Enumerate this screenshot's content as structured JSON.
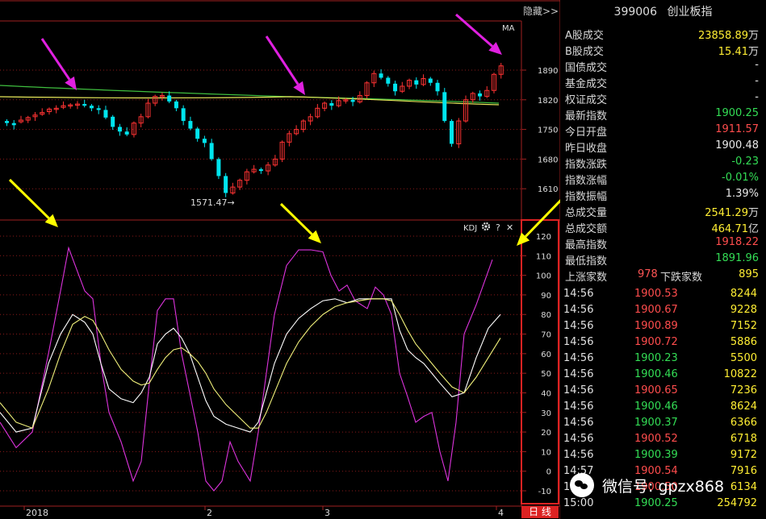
{
  "header": {
    "hide_label": "隐藏>>",
    "ma_label": "MA"
  },
  "sidebar": {
    "code": "399006",
    "name": "创业板指",
    "stats": [
      {
        "label": "A股成交",
        "value": "23858.89",
        "unit": "万",
        "color": "y"
      },
      {
        "label": "B股成交",
        "value": "15.41",
        "unit": "万",
        "color": "y"
      },
      {
        "label": "国债成交",
        "value": "-",
        "unit": "",
        "color": "w"
      },
      {
        "label": "基金成交",
        "value": "-",
        "unit": "",
        "color": "w"
      },
      {
        "label": "权证成交",
        "value": "-",
        "unit": "",
        "color": "w"
      },
      {
        "label": "最新指数",
        "value": "1900.25",
        "unit": "",
        "color": "g"
      },
      {
        "label": "今日开盘",
        "value": "1911.57",
        "unit": "",
        "color": "r"
      },
      {
        "label": "昨日收盘",
        "value": "1900.48",
        "unit": "",
        "color": "w"
      },
      {
        "label": "指数涨跌",
        "value": "-0.23",
        "unit": "",
        "color": "g"
      },
      {
        "label": "指数涨幅",
        "value": "-0.01%",
        "unit": "",
        "color": "g"
      },
      {
        "label": "指数振幅",
        "value": "1.39%",
        "unit": "",
        "color": "w"
      },
      {
        "label": "总成交量",
        "value": "2541.29",
        "unit": "万",
        "color": "y"
      },
      {
        "label": "总成交额",
        "value": "464.71",
        "unit": "亿",
        "color": "y"
      },
      {
        "label": "最高指数",
        "value": "1918.22",
        "unit": "",
        "color": "r"
      },
      {
        "label": "最低指数",
        "value": "1891.96",
        "unit": "",
        "color": "g"
      }
    ],
    "breadth": {
      "up_label": "上涨家数",
      "up_value": "978",
      "down_label": "下跌家数",
      "down_value": "895"
    },
    "ticks": [
      {
        "time": "14:56",
        "price": "1900.53",
        "vol": "8244",
        "color": "r"
      },
      {
        "time": "14:56",
        "price": "1900.67",
        "vol": "9228",
        "color": "r"
      },
      {
        "time": "14:56",
        "price": "1900.89",
        "vol": "7152",
        "color": "r"
      },
      {
        "time": "14:56",
        "price": "1900.72",
        "vol": "5886",
        "color": "r"
      },
      {
        "time": "14:56",
        "price": "1900.23",
        "vol": "5500",
        "color": "g"
      },
      {
        "time": "14:56",
        "price": "1900.46",
        "vol": "10822",
        "color": "g"
      },
      {
        "time": "14:56",
        "price": "1900.65",
        "vol": "7236",
        "color": "r"
      },
      {
        "time": "14:56",
        "price": "1900.46",
        "vol": "8624",
        "color": "g"
      },
      {
        "time": "14:56",
        "price": "1900.37",
        "vol": "6366",
        "color": "g"
      },
      {
        "time": "14:56",
        "price": "1900.52",
        "vol": "6718",
        "color": "r"
      },
      {
        "time": "14:56",
        "price": "1900.39",
        "vol": "9172",
        "color": "g"
      },
      {
        "time": "14:57",
        "price": "1900.54",
        "vol": "7916",
        "color": "r"
      },
      {
        "time": "14:57",
        "price": "1900.50",
        "vol": "6134",
        "color": "r"
      },
      {
        "time": "15:00",
        "price": "1900.25",
        "vol": "254792",
        "color": "g"
      }
    ]
  },
  "price_chart": {
    "y_ticks": [
      "1890",
      "1820",
      "1750",
      "1680",
      "1610"
    ],
    "low_annotation": "1571.47→"
  },
  "kdj": {
    "title": "KDJ",
    "settings_icon": "gear-icon",
    "help_label": "?",
    "close_label": "✕",
    "y_ticks": [
      "120",
      "110",
      "100",
      "90",
      "80",
      "70",
      "60",
      "50",
      "40",
      "30",
      "20",
      "10",
      "0",
      "-10"
    ]
  },
  "x_axis": {
    "labels": [
      "2018",
      "2",
      "3",
      "4"
    ]
  },
  "period_button": "日 线",
  "watermark": "微信号: gpzx868",
  "colors": {
    "up": "#ff3333",
    "down": "#00e5ee",
    "ma_yellow": "#e8e85a",
    "ma_green": "#3fbf3f",
    "k_line": "#ffffff",
    "d_line": "#f0f07a",
    "j_line": "#dd33dd",
    "grid": "#8b1a1a",
    "arrow_magenta": "#e020e0",
    "arrow_yellow": "#ffff00"
  }
}
